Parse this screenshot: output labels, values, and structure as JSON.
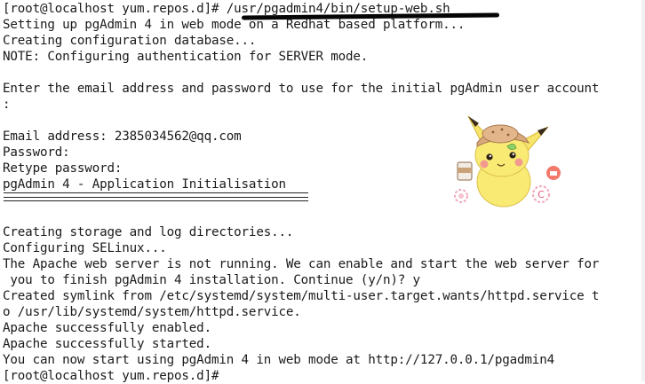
{
  "terminal": {
    "lines": [
      "[root@localhost yum.repos.d]# /usr/pgadmin4/bin/setup-web.sh",
      "Setting up pgAdmin 4 in web mode on a Redhat based platform...",
      "Creating configuration database...",
      "NOTE: Configuring authentication for SERVER mode.",
      "",
      "Enter the email address and password to use for the initial pgAdmin user account",
      ":",
      "",
      "Email address: 2385034562@qq.com",
      "Password:",
      "Retype password:",
      "pgAdmin 4 - Application Initialisation",
      "",
      "",
      "Creating storage and log directories...",
      "Configuring SELinux...",
      "The Apache web server is not running. We can enable and start the web server for",
      " you to finish pgAdmin 4 installation. Continue (y/n)? y",
      "Created symlink from /etc/systemd/system/multi-user.target.wants/httpd.service t",
      "o /usr/lib/systemd/system/httpd.service.",
      "Apache successfully enabled.",
      "Apache successfully started.",
      "You can now start using pgAdmin 4 in web mode at http://127.0.0.1/pgadmin4",
      "[root@localhost yum.repos.d]# "
    ]
  },
  "icons": {
    "mascot": "pikachu-detective-sticker"
  },
  "colors": {
    "background": "#ffffff",
    "text": "#1a1a1a",
    "annotation": "#050505"
  }
}
